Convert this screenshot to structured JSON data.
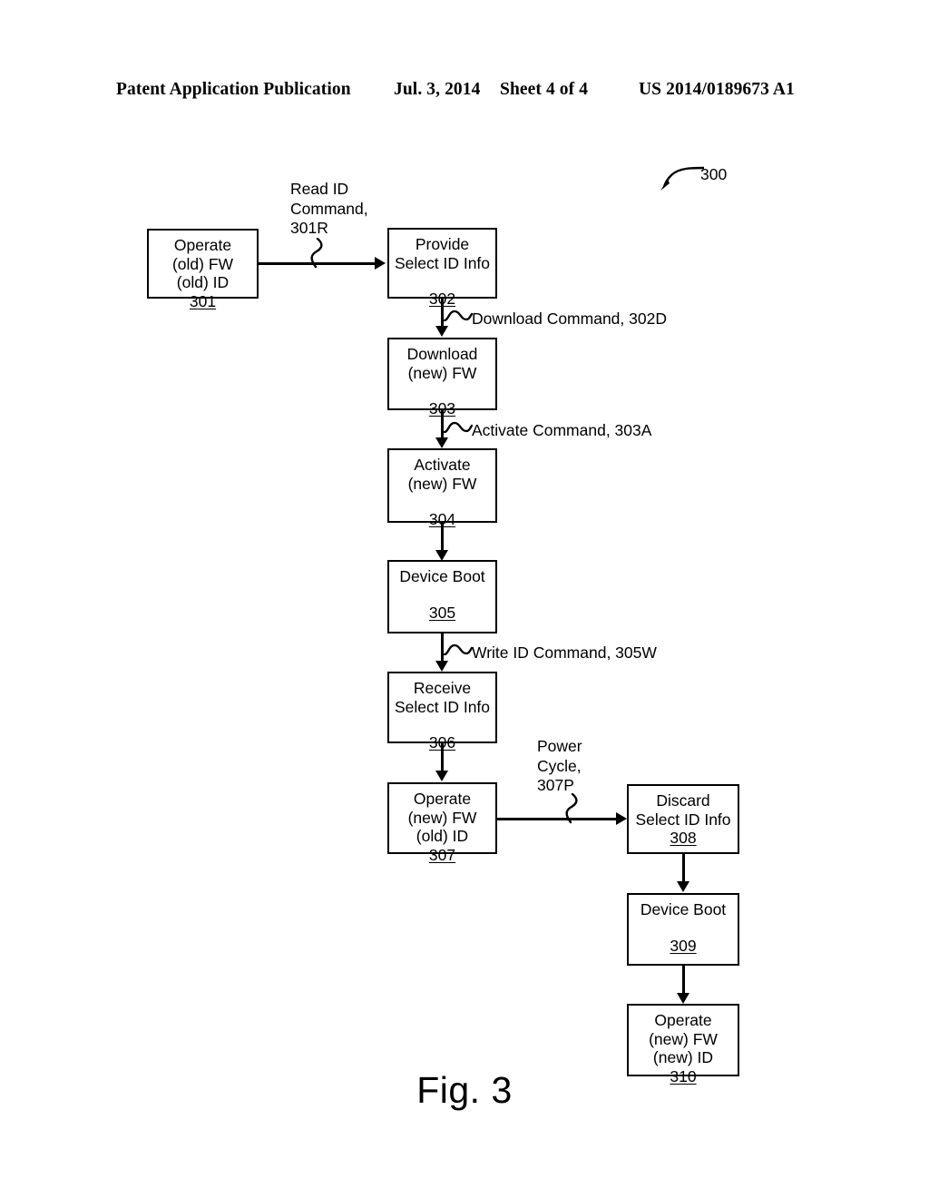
{
  "header": {
    "publication": "Patent Application Publication",
    "date": "Jul. 3, 2014",
    "sheet": "Sheet 4 of 4",
    "document_number": "US 2014/0189673 A1"
  },
  "figure": {
    "caption": "Fig. 3",
    "diagram_reference": "300"
  },
  "nodes": [
    {
      "id": "301",
      "text": "Operate\n(old) FW\n(old) ID",
      "ref": "301"
    },
    {
      "id": "302",
      "text": "Provide\nSelect ID Info",
      "ref": "302"
    },
    {
      "id": "303",
      "text": "Download\n(new) FW",
      "ref": "303"
    },
    {
      "id": "304",
      "text": "Activate\n(new) FW",
      "ref": "304"
    },
    {
      "id": "305",
      "text": "Device Boot",
      "ref": "305"
    },
    {
      "id": "306",
      "text": "Receive\nSelect ID Info",
      "ref": "306"
    },
    {
      "id": "307",
      "text": "Operate\n(new) FW\n(old) ID",
      "ref": "307"
    },
    {
      "id": "308",
      "text": "Discard\nSelect ID Info",
      "ref": "308"
    },
    {
      "id": "309",
      "text": "Device Boot",
      "ref": "309"
    },
    {
      "id": "310",
      "text": "Operate\n(new) FW\n(new) ID",
      "ref": "310"
    }
  ],
  "edge_labels": {
    "read_id": "Read ID\nCommand,\n301R",
    "download": "Download Command, 302D",
    "activate": "Activate Command, 303A",
    "write_id": "Write ID Command, 305W",
    "power_cycle": "Power\nCycle,\n307P"
  }
}
